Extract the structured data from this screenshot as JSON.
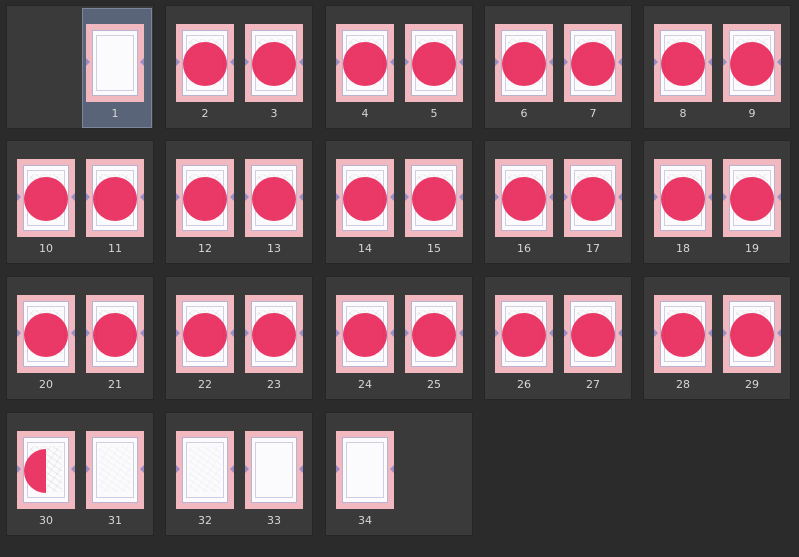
{
  "pages": [
    {
      "num": "1"
    },
    {
      "num": "2"
    },
    {
      "num": "3"
    },
    {
      "num": "4"
    },
    {
      "num": "5"
    },
    {
      "num": "6"
    },
    {
      "num": "7"
    },
    {
      "num": "8"
    },
    {
      "num": "9"
    },
    {
      "num": "10"
    },
    {
      "num": "11"
    },
    {
      "num": "12"
    },
    {
      "num": "13"
    },
    {
      "num": "14"
    },
    {
      "num": "15"
    },
    {
      "num": "16"
    },
    {
      "num": "17"
    },
    {
      "num": "18"
    },
    {
      "num": "19"
    },
    {
      "num": "20"
    },
    {
      "num": "21"
    },
    {
      "num": "22"
    },
    {
      "num": "23"
    },
    {
      "num": "24"
    },
    {
      "num": "25"
    },
    {
      "num": "26"
    },
    {
      "num": "27"
    },
    {
      "num": "28"
    },
    {
      "num": "29"
    },
    {
      "num": "30"
    },
    {
      "num": "31"
    },
    {
      "num": "32"
    },
    {
      "num": "33"
    },
    {
      "num": "34"
    }
  ],
  "selected_page": "1",
  "colors": {
    "background": "#2b2b2b",
    "spread": "#3a3a3a",
    "page_border": "#f2b8c0",
    "marker": "#e8275a",
    "selected": "#5a6478"
  }
}
